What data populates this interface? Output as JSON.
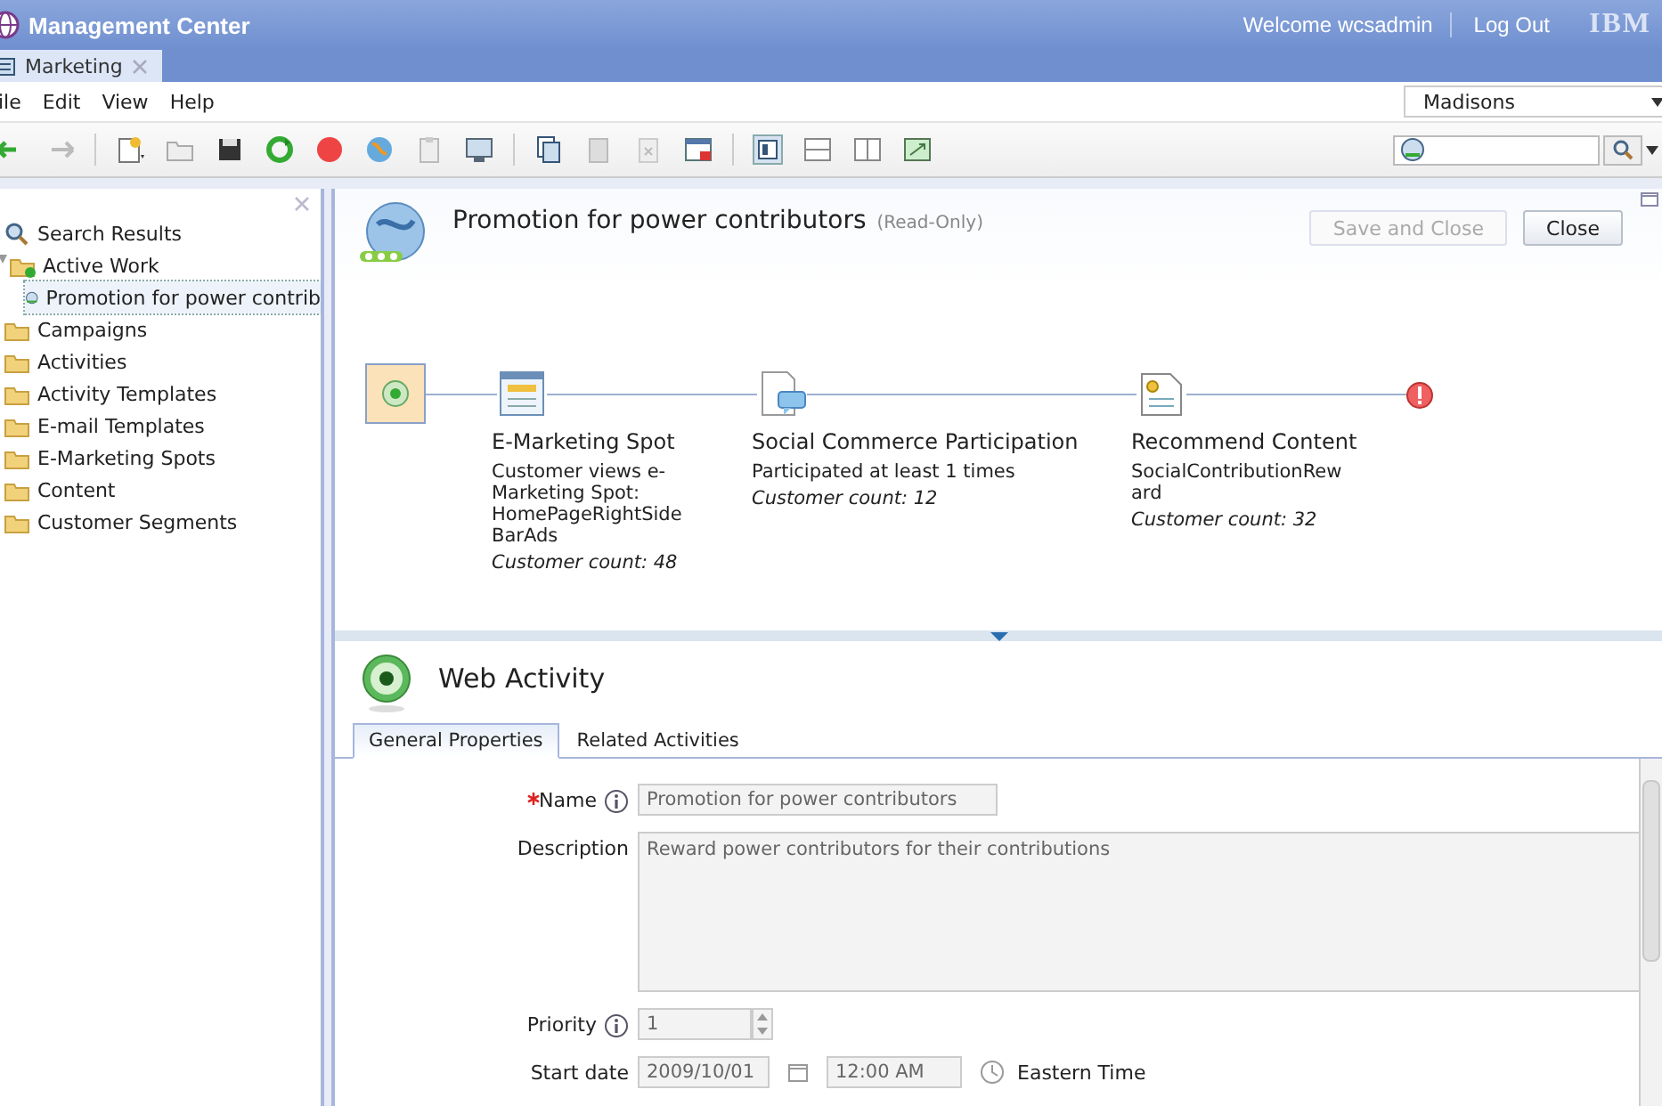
{
  "header": {
    "title": "Management Center",
    "welcome": "Welcome wcsadmin",
    "logout": "Log Out",
    "logo": "IBM"
  },
  "app_tabs": [
    {
      "label": "Marketing",
      "selected": true
    }
  ],
  "menu": [
    "ile",
    "Edit",
    "View",
    "Help"
  ],
  "store_selector": {
    "value": "Madisons"
  },
  "sidebar": {
    "items": [
      {
        "kind": "search",
        "label": "Search Results",
        "selected": false
      },
      {
        "kind": "active",
        "label": "Active Work",
        "selected": false,
        "expanded": true,
        "children": [
          {
            "kind": "activity",
            "label": "Promotion for power contrib",
            "selected": true
          }
        ]
      },
      {
        "kind": "folder",
        "label": "Campaigns",
        "selected": false
      },
      {
        "kind": "folder",
        "label": "Activities",
        "selected": false
      },
      {
        "kind": "folder",
        "label": "Activity Templates",
        "selected": false
      },
      {
        "kind": "folder",
        "label": "E-mail Templates",
        "selected": false
      },
      {
        "kind": "folder",
        "label": "E-Marketing Spots",
        "selected": false
      },
      {
        "kind": "folder",
        "label": "Content",
        "selected": false
      },
      {
        "kind": "folder",
        "label": "Customer Segments",
        "selected": false
      }
    ]
  },
  "editor": {
    "title": "Promotion for power contributors",
    "status": "(Read-Only)",
    "buttons": [
      {
        "label": "Save and Close",
        "disabled": true
      },
      {
        "label": "Close",
        "disabled": false
      }
    ],
    "flow": [
      {
        "kind": "start"
      },
      {
        "kind": "spot",
        "title": "E-Marketing Spot",
        "detail": "Customer views e-Marketing Spot: HomePageRightSideBarAds",
        "count": "Customer count: 48"
      },
      {
        "kind": "social",
        "title": "Social Commerce Participation",
        "detail": "Participated at least 1 times",
        "count": "Customer count: 12"
      },
      {
        "kind": "content",
        "title": "Recommend Content",
        "detail": "SocialContributionReward",
        "count": "Customer count: 32"
      },
      {
        "kind": "end"
      }
    ]
  },
  "properties": {
    "title": "Web Activity",
    "tabs": [
      {
        "label": "General Properties",
        "selected": true
      },
      {
        "label": "Related Activities",
        "selected": false
      }
    ],
    "fields": [
      {
        "kind": "text",
        "label": "Name",
        "required": true,
        "info": true,
        "value": "Promotion for power contributors"
      },
      {
        "kind": "textarea",
        "label": "Description",
        "required": false,
        "info": false,
        "value": "Reward power contributors for their contributions"
      },
      {
        "kind": "spinner",
        "label": "Priority",
        "required": false,
        "info": true,
        "value": "1"
      },
      {
        "kind": "datetime",
        "label": "Start date",
        "required": false,
        "info": false,
        "value": "2009/10/01",
        "time": "12:00 AM",
        "zone": "Eastern Time"
      }
    ]
  }
}
